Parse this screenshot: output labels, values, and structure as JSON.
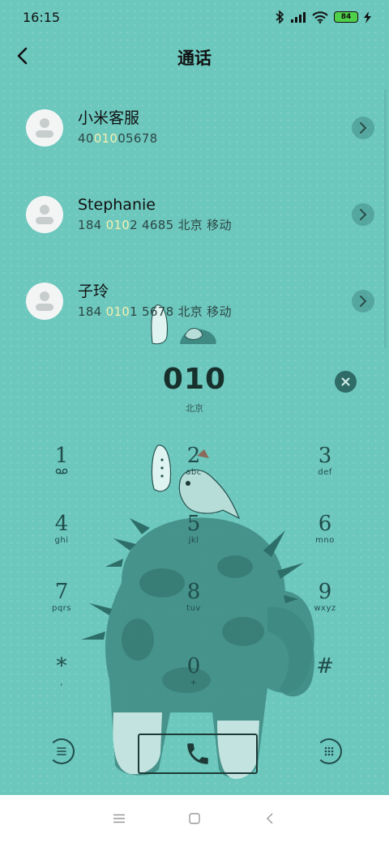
{
  "status_bar": {
    "time": "16:15",
    "battery_level": "84",
    "icons": [
      "bluetooth-icon",
      "signal-icon",
      "wifi-icon",
      "battery-icon",
      "charging-icon"
    ]
  },
  "header": {
    "title": "通话"
  },
  "contacts": [
    {
      "name": "小米客服",
      "number_prefix": "40",
      "number_match": "010",
      "number_suffix": "05678"
    },
    {
      "name": "Stephanie",
      "number_prefix": "184 ",
      "number_match": "010",
      "number_suffix": "2 4685  北京 移动"
    },
    {
      "name": "子玲",
      "number_prefix": "184 ",
      "number_match": "010",
      "number_suffix": "1 5678  北京 移动"
    }
  ],
  "dialer": {
    "number": "010",
    "location": "北京"
  },
  "keypad": [
    {
      "digit": "1",
      "letters": ""
    },
    {
      "digit": "2",
      "letters": "abc"
    },
    {
      "digit": "3",
      "letters": "def"
    },
    {
      "digit": "4",
      "letters": "ghi"
    },
    {
      "digit": "5",
      "letters": "jkl"
    },
    {
      "digit": "6",
      "letters": "mno"
    },
    {
      "digit": "7",
      "letters": "pqrs"
    },
    {
      "digit": "8",
      "letters": "tuv"
    },
    {
      "digit": "9",
      "letters": "wxyz"
    },
    {
      "digit": "*",
      "letters": ","
    },
    {
      "digit": "0",
      "letters": "+"
    },
    {
      "digit": "#",
      "letters": ""
    }
  ],
  "colors": {
    "background": "#6cc7bd",
    "highlight": "#f4f0b0",
    "key_ink": "#1f4d4a",
    "nav_bar": "#ffffff"
  }
}
